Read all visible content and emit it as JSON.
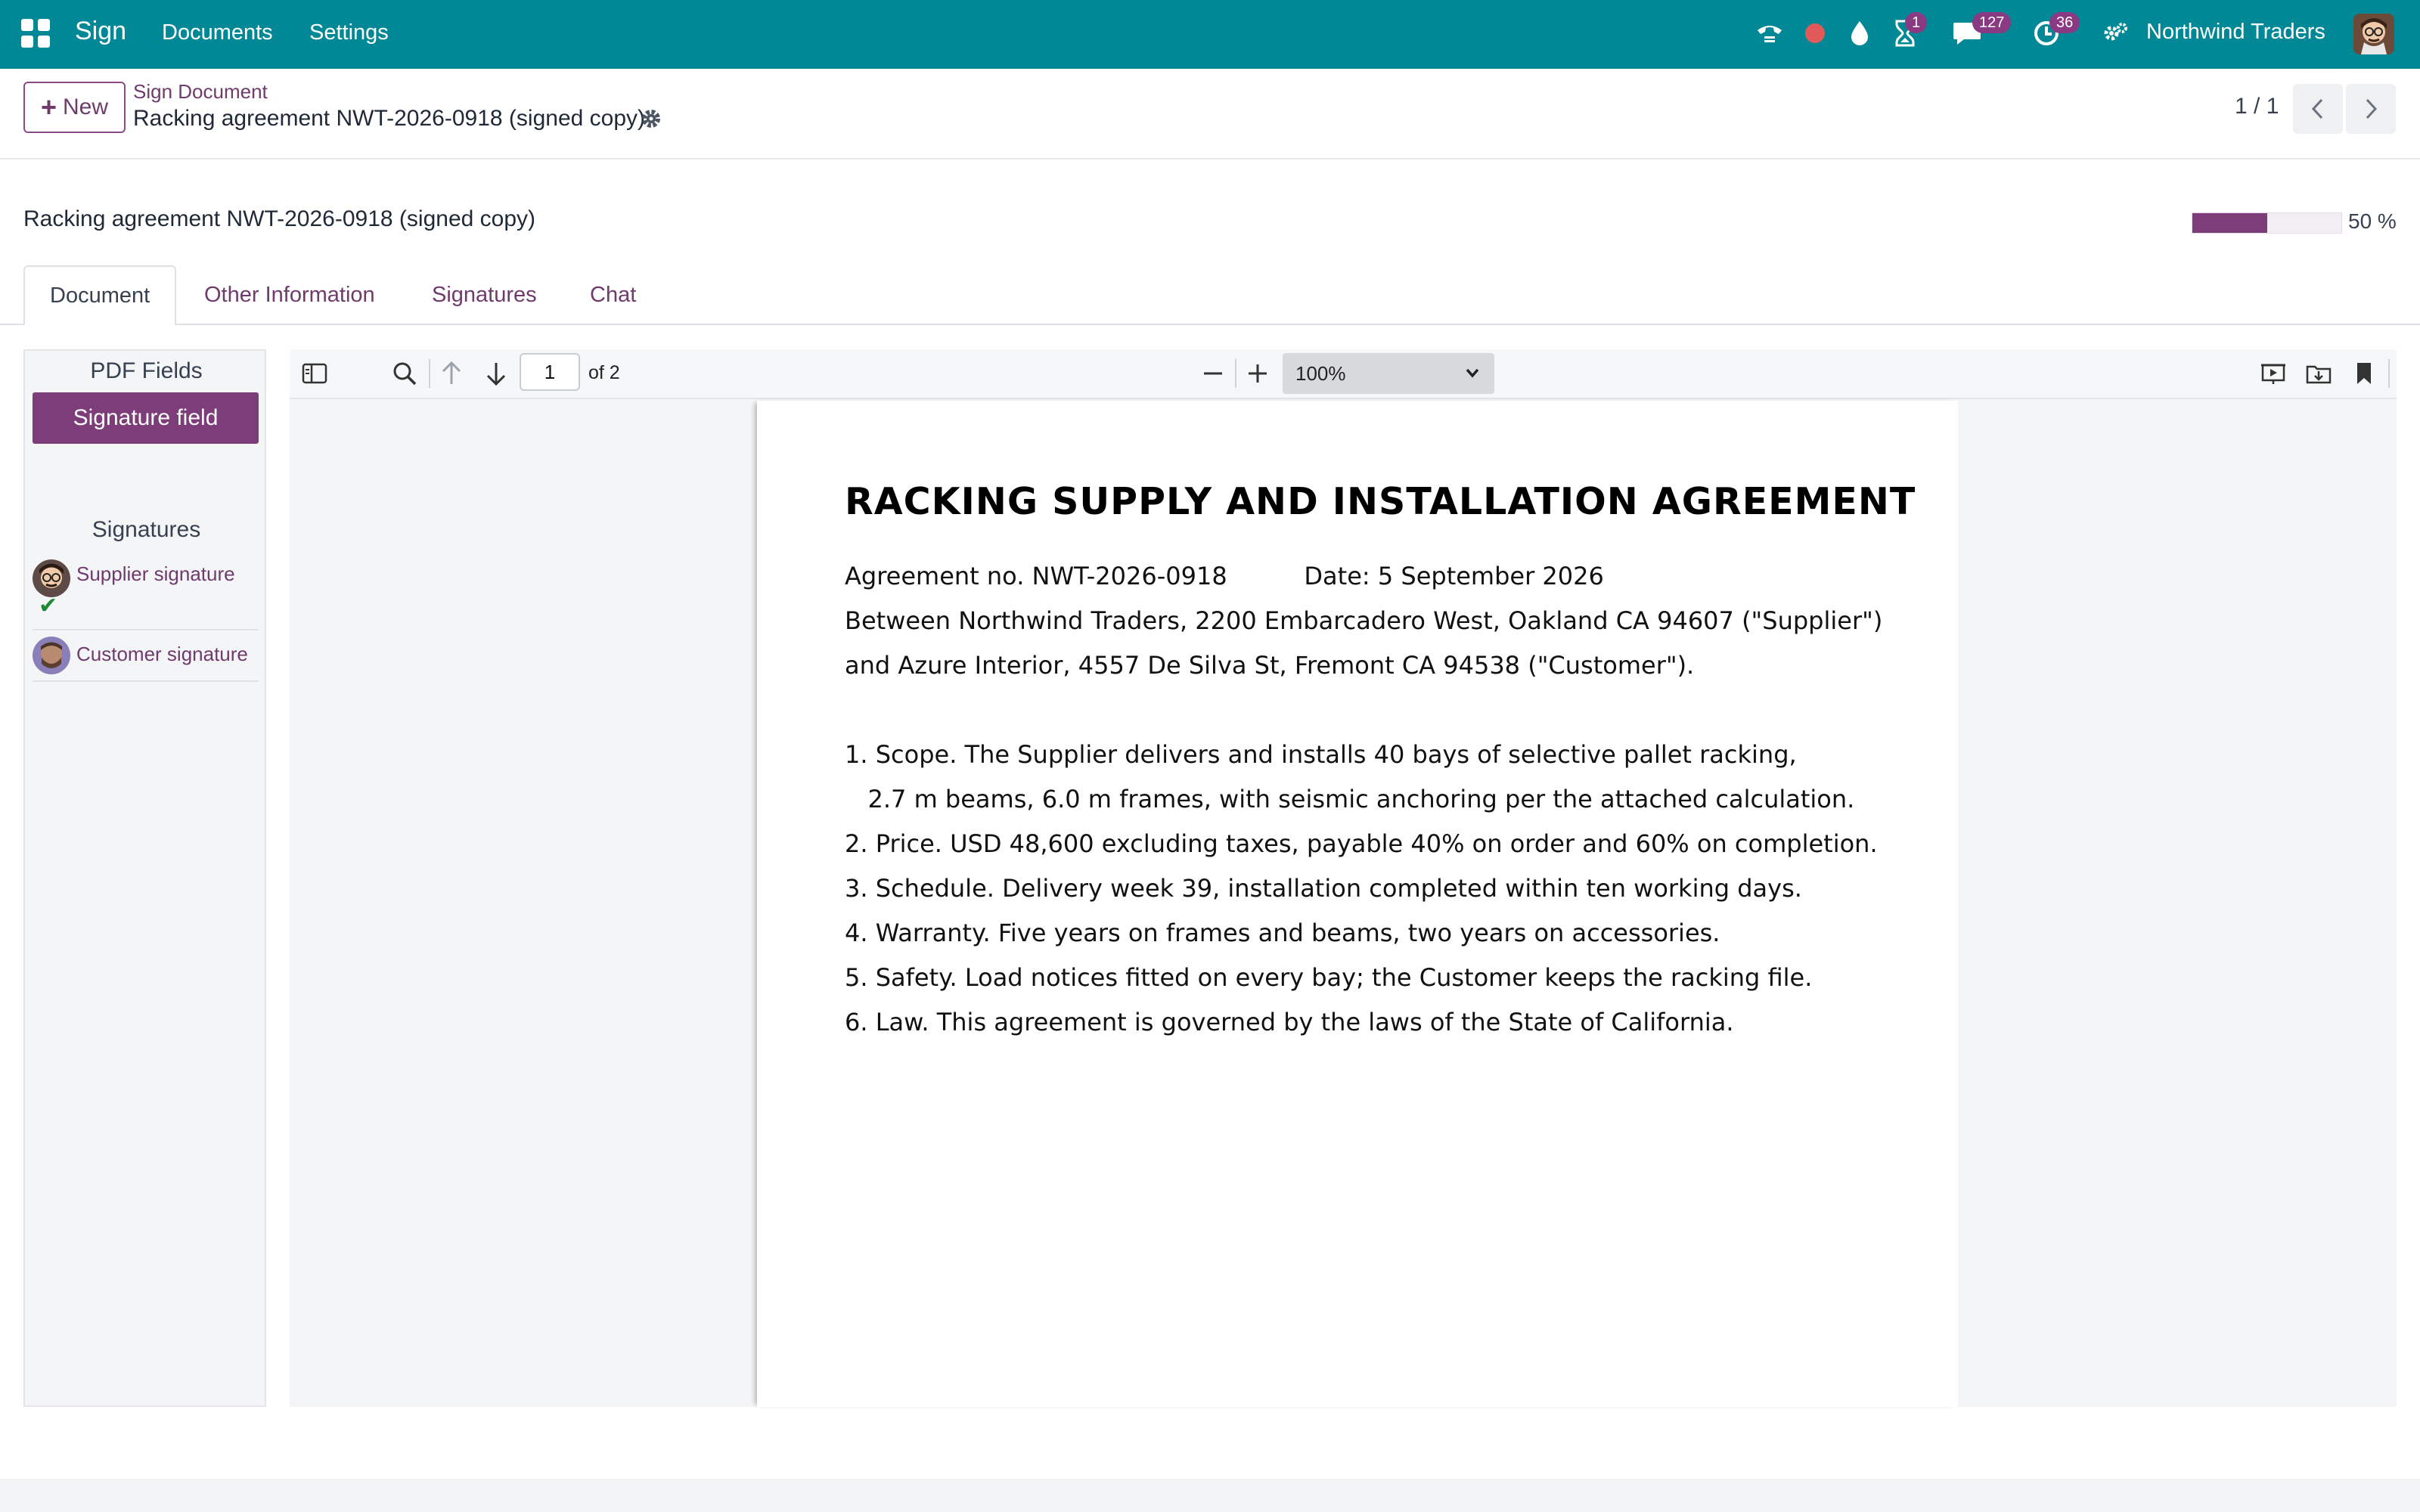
{
  "colors": {
    "brand": "#008896",
    "accent": "#7d3d79",
    "badge": "#8a3a82",
    "success": "#1e8a37"
  },
  "topbar": {
    "app_name": "Sign",
    "menu": [
      "Documents",
      "Settings"
    ],
    "icons": [
      "phone-icon",
      "recording-dot-icon",
      "drop-icon",
      "hourglass-icon",
      "chat-icon",
      "clock-icon",
      "settings-cog-icon"
    ],
    "badges": {
      "activities": "1",
      "messages": "127",
      "clock": "36"
    },
    "company": "Northwind Traders"
  },
  "control_panel": {
    "new_label": "New",
    "breadcrumb_parent": "Sign Document",
    "breadcrumb_current": "Racking agreement NWT-2026-0918 (signed copy)",
    "pager": "1 / 1"
  },
  "form": {
    "title": "Racking agreement NWT-2026-0918 (signed copy)",
    "progress_percent": 50,
    "progress_label": "50 %",
    "tabs": [
      "Document",
      "Other Information",
      "Signatures",
      "Chat"
    ]
  },
  "side": {
    "pdf_fields_heading": "PDF Fields",
    "signature_field_label": "Signature field",
    "signatures_heading": "Signatures",
    "signers": [
      {
        "name": "Supplier signature",
        "signed": true,
        "check": "✔"
      },
      {
        "name": "Customer signature",
        "signed": false
      }
    ]
  },
  "viewer": {
    "page_value": "1",
    "page_of": "of 2",
    "zoom": "100%"
  },
  "pdf": {
    "title": "RACKING SUPPLY AND INSTALLATION AGREEMENT",
    "lines": [
      "Agreement no. NWT-2026-0918          Date: 5 September 2026",
      "Between Northwind Traders, 2200 Embarcadero West, Oakland CA 94607 (\"Supplier\")",
      "and Azure Interior, 4557 De Silva St, Fremont CA 94538 (\"Customer\").",
      "1. Scope. The Supplier delivers and installs 40 bays of selective pallet racking,",
      "   2.7 m beams, 6.0 m frames, with seismic anchoring per the attached calculation.",
      "2. Price. USD 48,600 excluding taxes, payable 40% on order and 60% on completion.",
      "3. Schedule. Delivery week 39, installation completed within ten working days.",
      "4. Warranty. Five years on frames and beams, two years on accessories.",
      "5. Safety. Load notices fitted on every bay; the Customer keeps the racking file.",
      "6. Law. This agreement is governed by the laws of the State of California."
    ]
  }
}
